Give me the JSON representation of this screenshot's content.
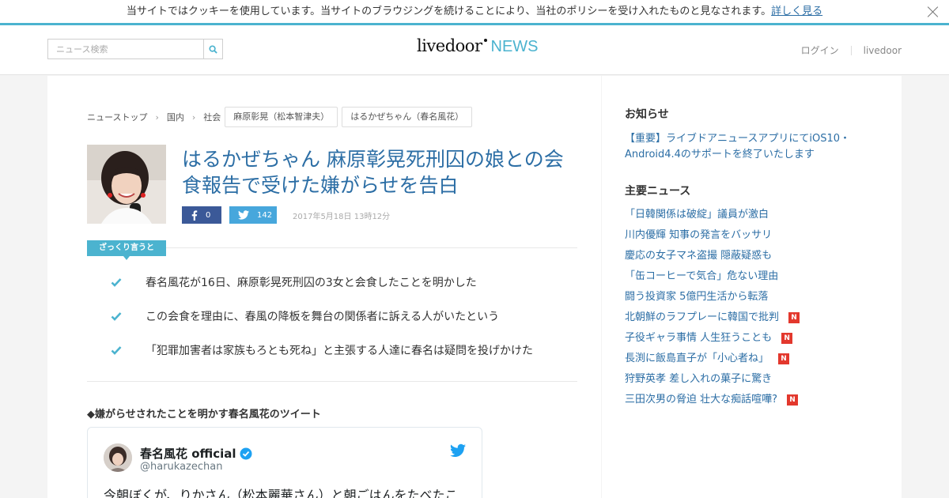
{
  "cookie": {
    "text": "当サイトではクッキーを使用しています。当サイトのブラウジングを続けることにより、当社のポリシーを受け入れたものと見なされます。",
    "more_link": "詳しく見る"
  },
  "header": {
    "search_placeholder": "ニュース検索",
    "logo_main": "livedoor",
    "logo_news": "NEWS",
    "nav": [
      "ログイン",
      "livedoor"
    ]
  },
  "breadcrumb": {
    "items": [
      "ニューストップ",
      "国内",
      "社会"
    ],
    "tags": [
      "麻原彰晃（松本智津夫）",
      "はるかぜちゃん（春名風花）"
    ]
  },
  "article": {
    "title": "はるかぜちゃん 麻原彰晃死刑囚の娘との会食報告で受けた嫌がらせを告白",
    "share": {
      "facebook_count": "0",
      "twitter_count": "142"
    },
    "date": "2017年5月18日 13時12分",
    "summary_label": "ざっくり言うと",
    "points": [
      "春名風花が16日、麻原彰晃死刑囚の3女と会食したことを明かした",
      "この会食を理由に、春風の降板を舞台の関係者に訴える人がいたという",
      "「犯罪加害者は家族もろとも死ね」と主張する人達に春名は疑問を投げかけた"
    ],
    "subheading": "◆嫌がらせされたことを明かす春名風花のツイート",
    "tweet": {
      "name": "春名風花 official",
      "handle": "@harukazechan",
      "text": "今朝ぼくが、りかさん（松本麗華さん）と朝ごはんをたべたこ"
    }
  },
  "sidebar": {
    "notice_title": "お知らせ",
    "notice_text": "【重要】ライブドアニュースアプリにてiOS10・Android4.4のサポートを終了いたします",
    "top_title": "主要ニュース",
    "top_news": [
      {
        "text": "「日韓関係は破綻」議員が激白",
        "new": false
      },
      {
        "text": "川内優輝 知事の発言をバッサリ",
        "new": false
      },
      {
        "text": "慶応の女子マネ盗撮 隠蔽疑惑も",
        "new": false
      },
      {
        "text": "「缶コーヒーで気合」危ない理由",
        "new": false
      },
      {
        "text": "闘う投資家 5億円生活から転落",
        "new": false
      },
      {
        "text": "北朝鮮のラフプレーに韓国で批判",
        "new": true
      },
      {
        "text": "子役ギャラ事情 人生狂うことも",
        "new": true
      },
      {
        "text": "長渕に飯島直子が「小心者ね」",
        "new": true
      },
      {
        "text": "狩野英孝 差し入れの菓子に驚き",
        "new": false
      },
      {
        "text": "三田次男の脅迫 壮大な痴話喧嘩?",
        "new": true
      }
    ],
    "new_badge": "N"
  },
  "colors": {
    "accent": "#4bb3cf",
    "link": "#2c6ea5",
    "facebook": "#3b5998",
    "twitter": "#47a7dc",
    "new_badge": "#e3382d"
  }
}
